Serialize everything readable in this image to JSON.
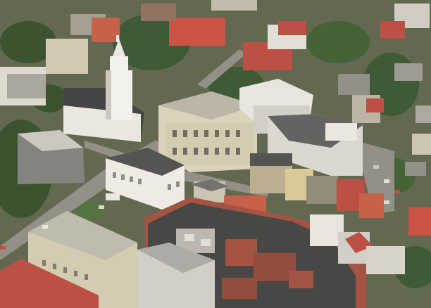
{
  "scene": {
    "palette": {
      "ground": "#5a5f47",
      "trees": "#2f4a22",
      "trees_light": "#4c6a36",
      "street": "#8d8a80",
      "roof_white": "#e6e4dc",
      "roof_grey": "#9a9a94",
      "roof_dark": "#3a3a3a",
      "roof_red": "#b8463a",
      "facade_cream": "#d8d0b6",
      "facade_shadow": "#8c8470",
      "steeple": "#f2f1ea"
    }
  }
}
